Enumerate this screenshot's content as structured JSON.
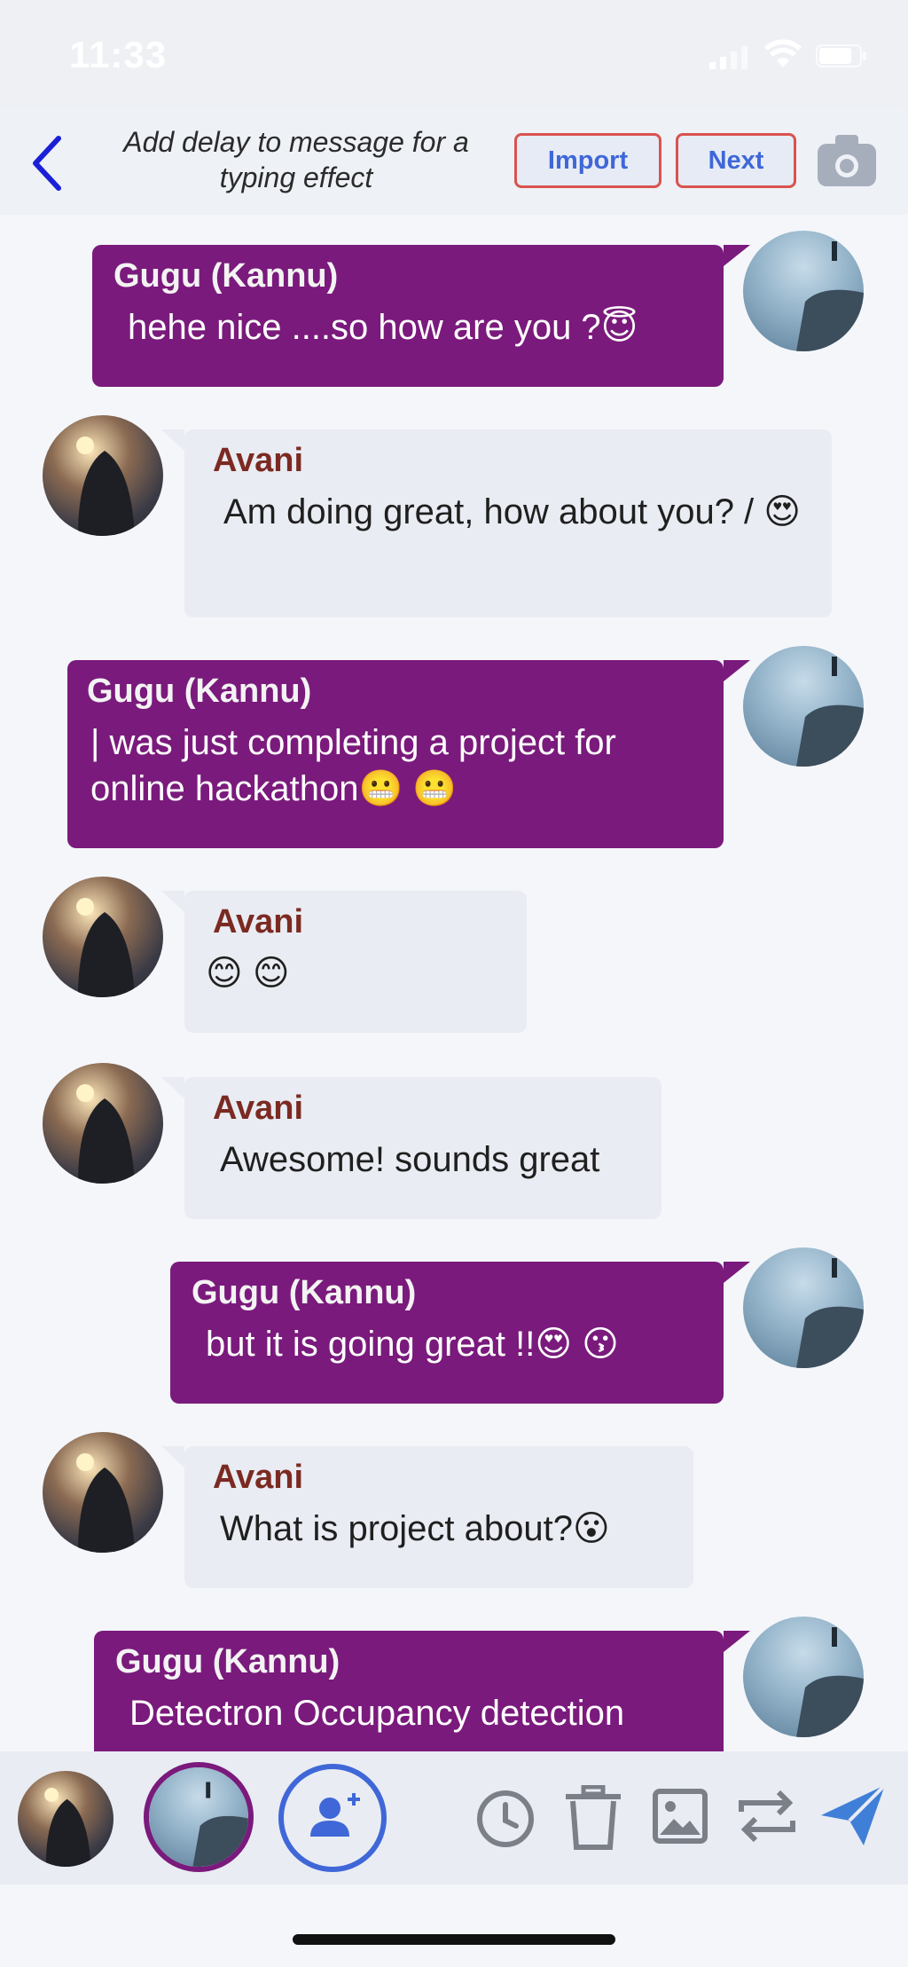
{
  "status": {
    "time": "11:33"
  },
  "header": {
    "hint": "Add delay to message for a typing effect",
    "import_label": "Import",
    "next_label": "Next"
  },
  "messages": [
    {
      "side": "right",
      "sender": "Gugu (Kannu)",
      "text": "hehe nice ....so how are you ?😇"
    },
    {
      "side": "left",
      "sender": "Avani",
      "text": "Am doing great, how about you? / 😍"
    },
    {
      "side": "right",
      "sender": "Gugu (Kannu)",
      "text": " | was just completing a project for online hackathon😬  😬"
    },
    {
      "side": "left",
      "sender": "Avani",
      "text": "😊  😊"
    },
    {
      "side": "left",
      "sender": "Avani",
      "text": "Awesome! sounds great"
    },
    {
      "side": "right",
      "sender": "Gugu (Kannu)",
      "text": "but it is going great !!😍  😗"
    },
    {
      "side": "left",
      "sender": "Avani",
      "text": "What is project about?😮"
    },
    {
      "side": "right",
      "sender": "Gugu (Kannu)",
      "text": "Detectron Occupancy detection"
    }
  ],
  "colors": {
    "sender_bubble": "#7a1a7c",
    "receiver_bubble": "#e9ecf2",
    "accent_blue": "#3f67d8",
    "button_border": "#d9534f"
  },
  "toolbar": {
    "icons": [
      "avatar-avani",
      "avatar-gugu-selected",
      "add-user-icon",
      "clock-icon",
      "trash-icon",
      "image-icon",
      "swap-icon",
      "send-icon"
    ]
  }
}
